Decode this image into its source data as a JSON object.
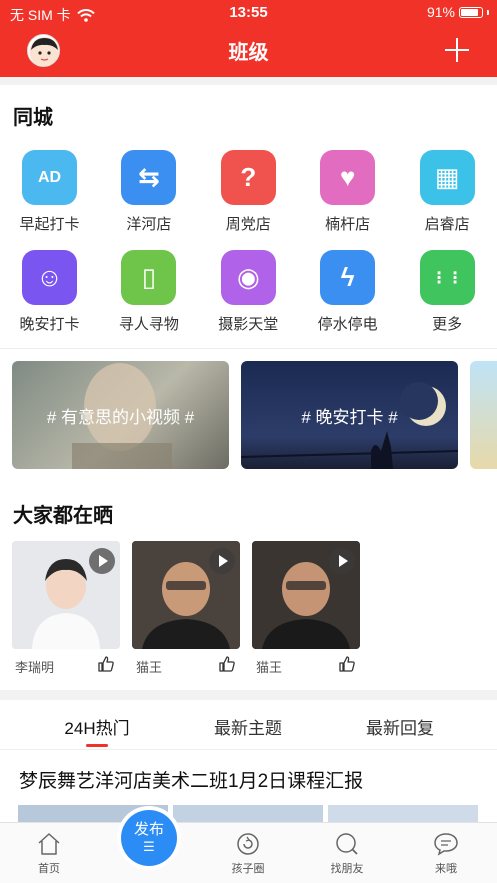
{
  "status": {
    "carrier": "无 SIM 卡",
    "time": "13:55",
    "battery": "91%"
  },
  "header": {
    "title": "班级"
  },
  "tongcheng": {
    "title": "同城",
    "items": [
      {
        "label": "早起打卡",
        "icon": "ad-board-icon",
        "color": "#4cb8f0",
        "glyph": "AD"
      },
      {
        "label": "洋河店",
        "icon": "signpost-icon",
        "color": "#3a8ff0",
        "glyph": "⇆"
      },
      {
        "label": "周党店",
        "icon": "question-icon",
        "color": "#f0534d",
        "glyph": "?"
      },
      {
        "label": "楠杆店",
        "icon": "cheers-icon",
        "color": "#e26cc0",
        "glyph": "♥"
      },
      {
        "label": "启睿店",
        "icon": "building-icon",
        "color": "#3cc2e8",
        "glyph": "▦"
      },
      {
        "label": "晚安打卡",
        "icon": "moon-face-icon",
        "color": "#7a55f0",
        "glyph": "☺"
      },
      {
        "label": "寻人寻物",
        "icon": "phone-shake-icon",
        "color": "#6fc44a",
        "glyph": "▯"
      },
      {
        "label": "摄影天堂",
        "icon": "camera-icon",
        "color": "#b062e8",
        "glyph": "◉"
      },
      {
        "label": "停水停电",
        "icon": "water-power-icon",
        "color": "#3a8ff0",
        "glyph": "ϟ"
      },
      {
        "label": "更多",
        "icon": "more-grid-icon",
        "color": "#3fc45e",
        "glyph": "⋮⋮"
      }
    ]
  },
  "banners": [
    {
      "label": "# 有意思的小视频 #"
    },
    {
      "label": "# 晚安打卡 #"
    }
  ],
  "shai": {
    "title": "大家都在晒",
    "posts": [
      {
        "name": "李瑞明"
      },
      {
        "name": "猫王"
      },
      {
        "name": "猫王"
      }
    ]
  },
  "tabs": {
    "items": [
      "24H热门",
      "最新主题",
      "最新回复"
    ],
    "active": 0
  },
  "post": {
    "title": "梦辰舞艺洋河店美术二班1月2日课程汇报"
  },
  "tabbar": {
    "items": [
      {
        "label": "首页",
        "icon": "home-icon"
      },
      {
        "label": "孩子圈",
        "icon": "circle-refresh-icon"
      },
      {
        "label": "找朋友",
        "icon": "search-friend-icon"
      },
      {
        "label": "来哦",
        "icon": "chat-bubble-icon"
      }
    ],
    "publish": "发布"
  },
  "colors": {
    "brand": "#f03229",
    "publish": "#2b8cf5"
  }
}
